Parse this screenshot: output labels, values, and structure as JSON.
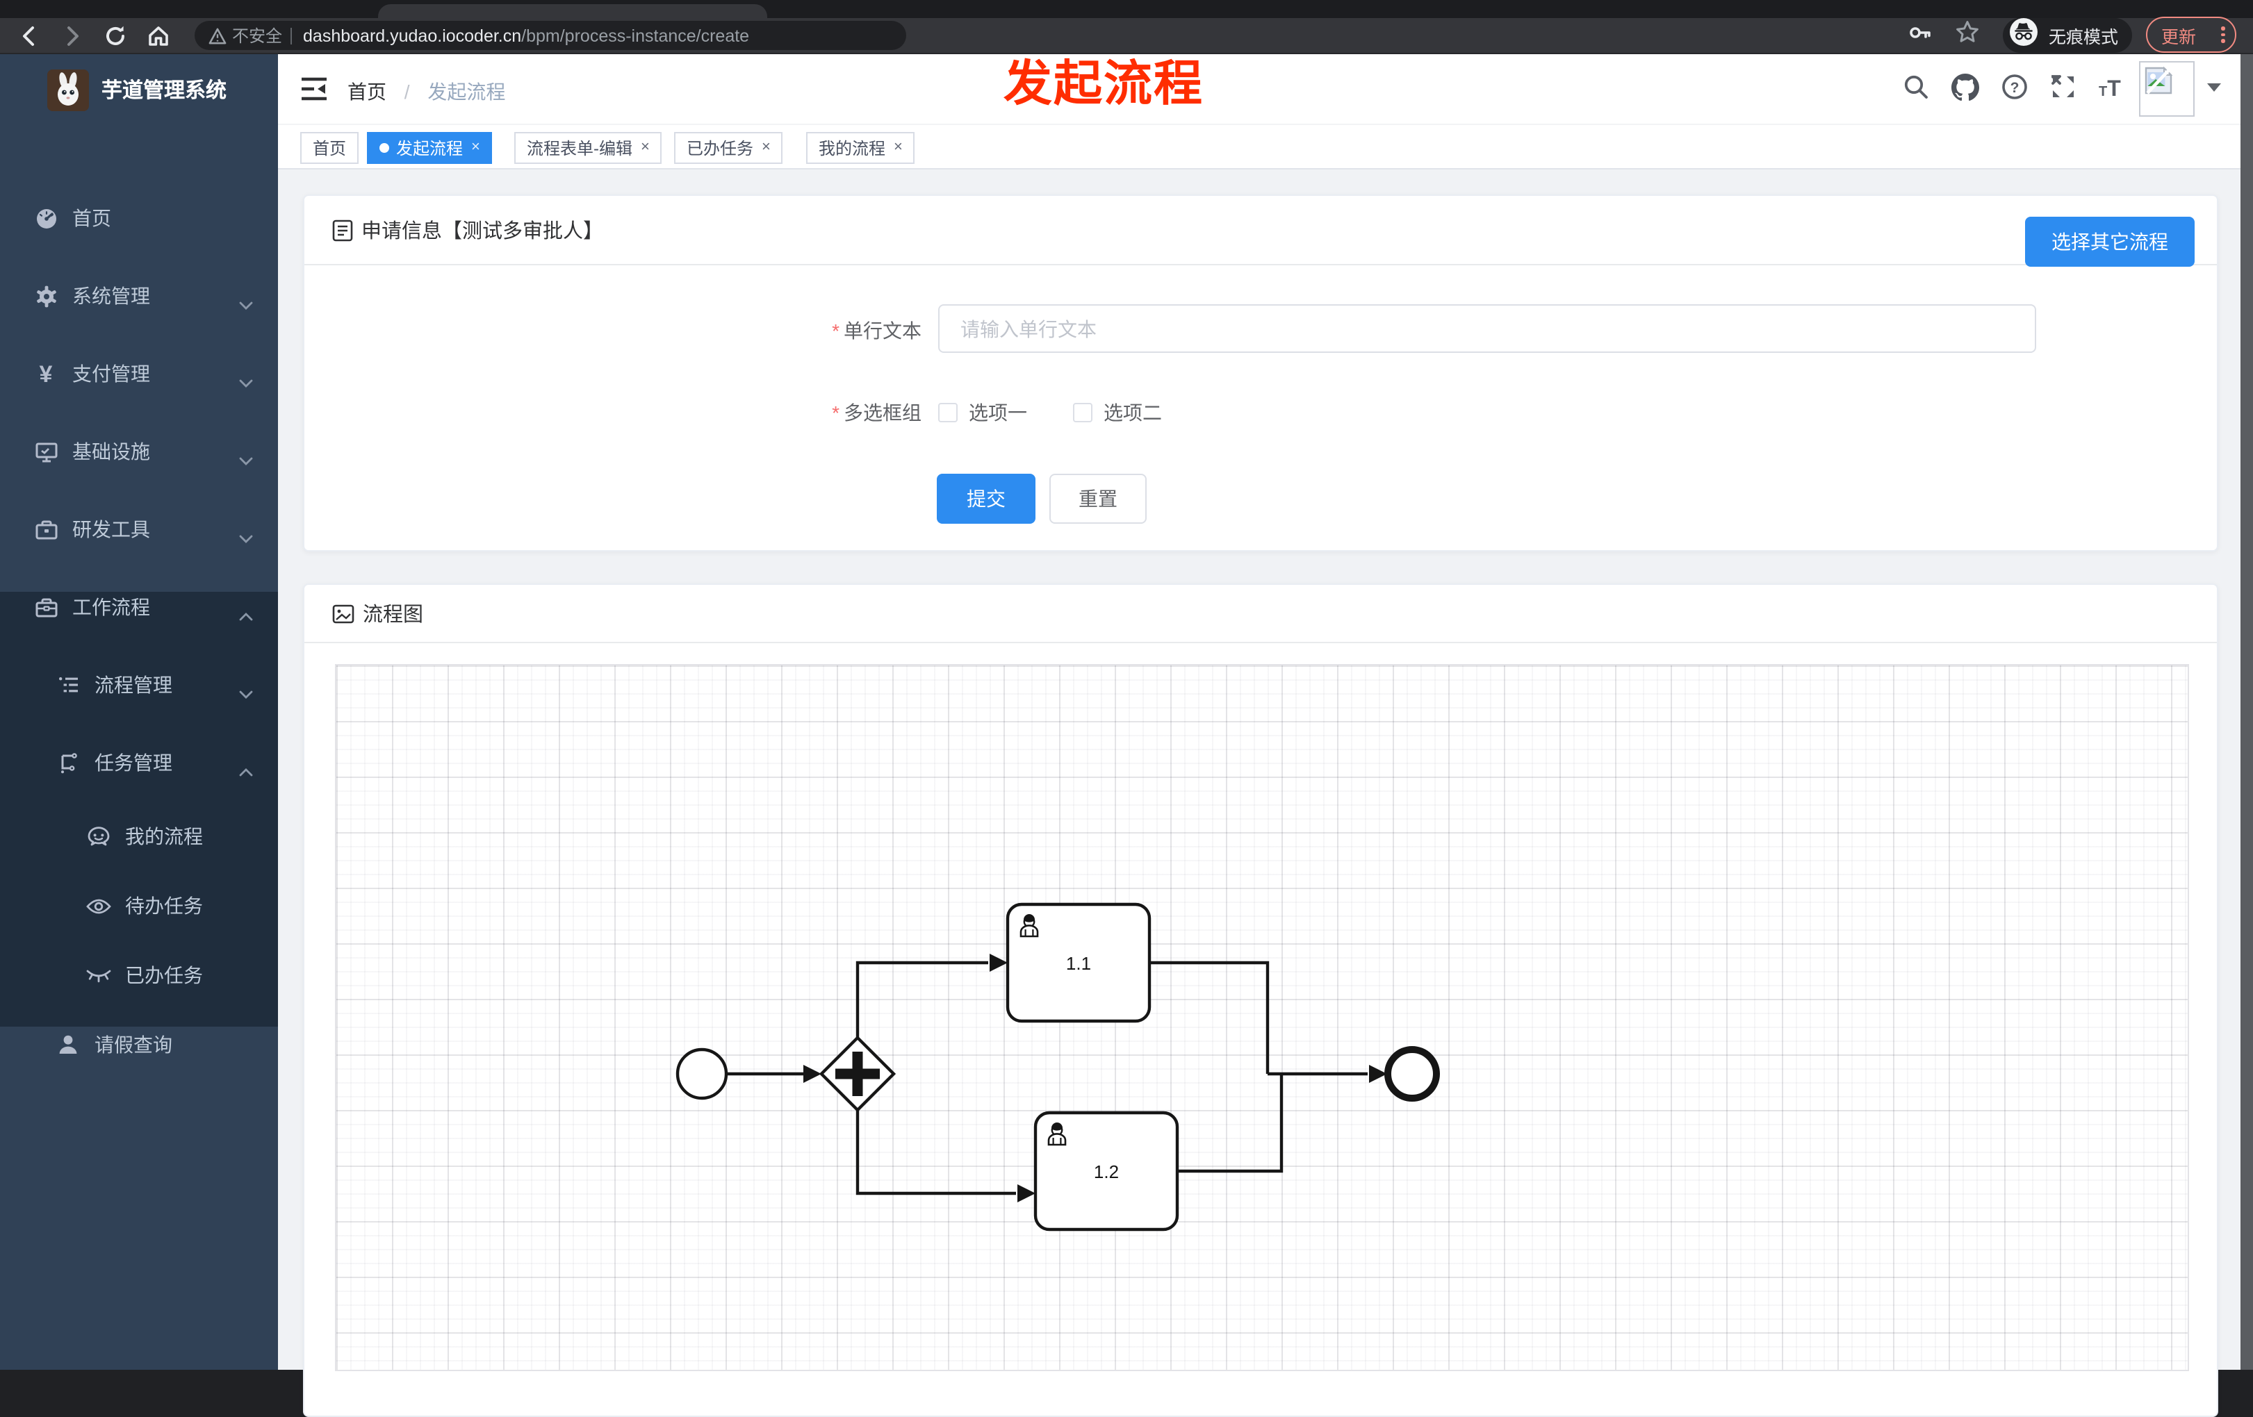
{
  "browser": {
    "url": {
      "security_label": "不安全",
      "host": "dashboard.yudao.iocoder.cn",
      "path": "/bpm/process-instance/create"
    },
    "incognito_label": "无痕模式",
    "update_label": "更新"
  },
  "overlay": {
    "text": "发起流程",
    "color": "#ff2d00"
  },
  "app": {
    "logo_title": "芋道管理系统",
    "breadcrumb": {
      "items": [
        "首页",
        "发起流程"
      ],
      "separator": "/"
    },
    "tabs": [
      {
        "label": "首页",
        "active": false,
        "closable": false
      },
      {
        "label": "发起流程",
        "active": true,
        "closable": true
      },
      {
        "label": "流程表单-编辑",
        "active": false,
        "closable": true
      },
      {
        "label": "已办任务",
        "active": false,
        "closable": true
      },
      {
        "label": "我的流程",
        "active": false,
        "closable": true
      }
    ]
  },
  "sidebar": {
    "items": [
      {
        "label": "首页",
        "icon": "dashboard-icon",
        "chevron": ""
      },
      {
        "label": "系统管理",
        "icon": "gear-icon",
        "chevron": "down"
      },
      {
        "label": "支付管理",
        "icon": "yen-icon",
        "chevron": "down"
      },
      {
        "label": "基础设施",
        "icon": "monitor-icon",
        "chevron": "down"
      },
      {
        "label": "研发工具",
        "icon": "toolbox-icon",
        "chevron": "down"
      },
      {
        "label": "工作流程",
        "icon": "briefcase-icon",
        "chevron": "up"
      },
      {
        "label": "流程管理",
        "icon": "flow-list-icon",
        "chevron": "down"
      },
      {
        "label": "任务管理",
        "icon": "tree-icon",
        "chevron": "up"
      },
      {
        "label": "我的流程",
        "icon": "robot-icon",
        "chevron": ""
      },
      {
        "label": "待办任务",
        "icon": "eye-open-icon",
        "chevron": ""
      },
      {
        "label": "已办任务",
        "icon": "eye-closed-icon",
        "chevron": ""
      },
      {
        "label": "请假查询",
        "icon": "user-icon",
        "chevron": ""
      }
    ]
  },
  "form_card": {
    "title": "申请信息【测试多审批人】",
    "choose_button": "选择其它流程",
    "fields": [
      {
        "label": "单行文本",
        "required": true,
        "placeholder": "请输入单行文本"
      },
      {
        "label": "多选框组",
        "required": true,
        "options": [
          "选项一",
          "选项二"
        ]
      }
    ],
    "submit_label": "提交",
    "reset_label": "重置"
  },
  "flow_card": {
    "title": "流程图",
    "nodes": {
      "task1": "1.1",
      "task2": "1.2"
    }
  },
  "colors": {
    "accent_blue": "#2d8cf0",
    "sidebar_bg": "#304156",
    "sidebar_sub_bg": "#1f2d3d",
    "overlay_red": "#ff2d00",
    "update_red": "#f28b82",
    "content_bg": "#f0f2f5"
  }
}
